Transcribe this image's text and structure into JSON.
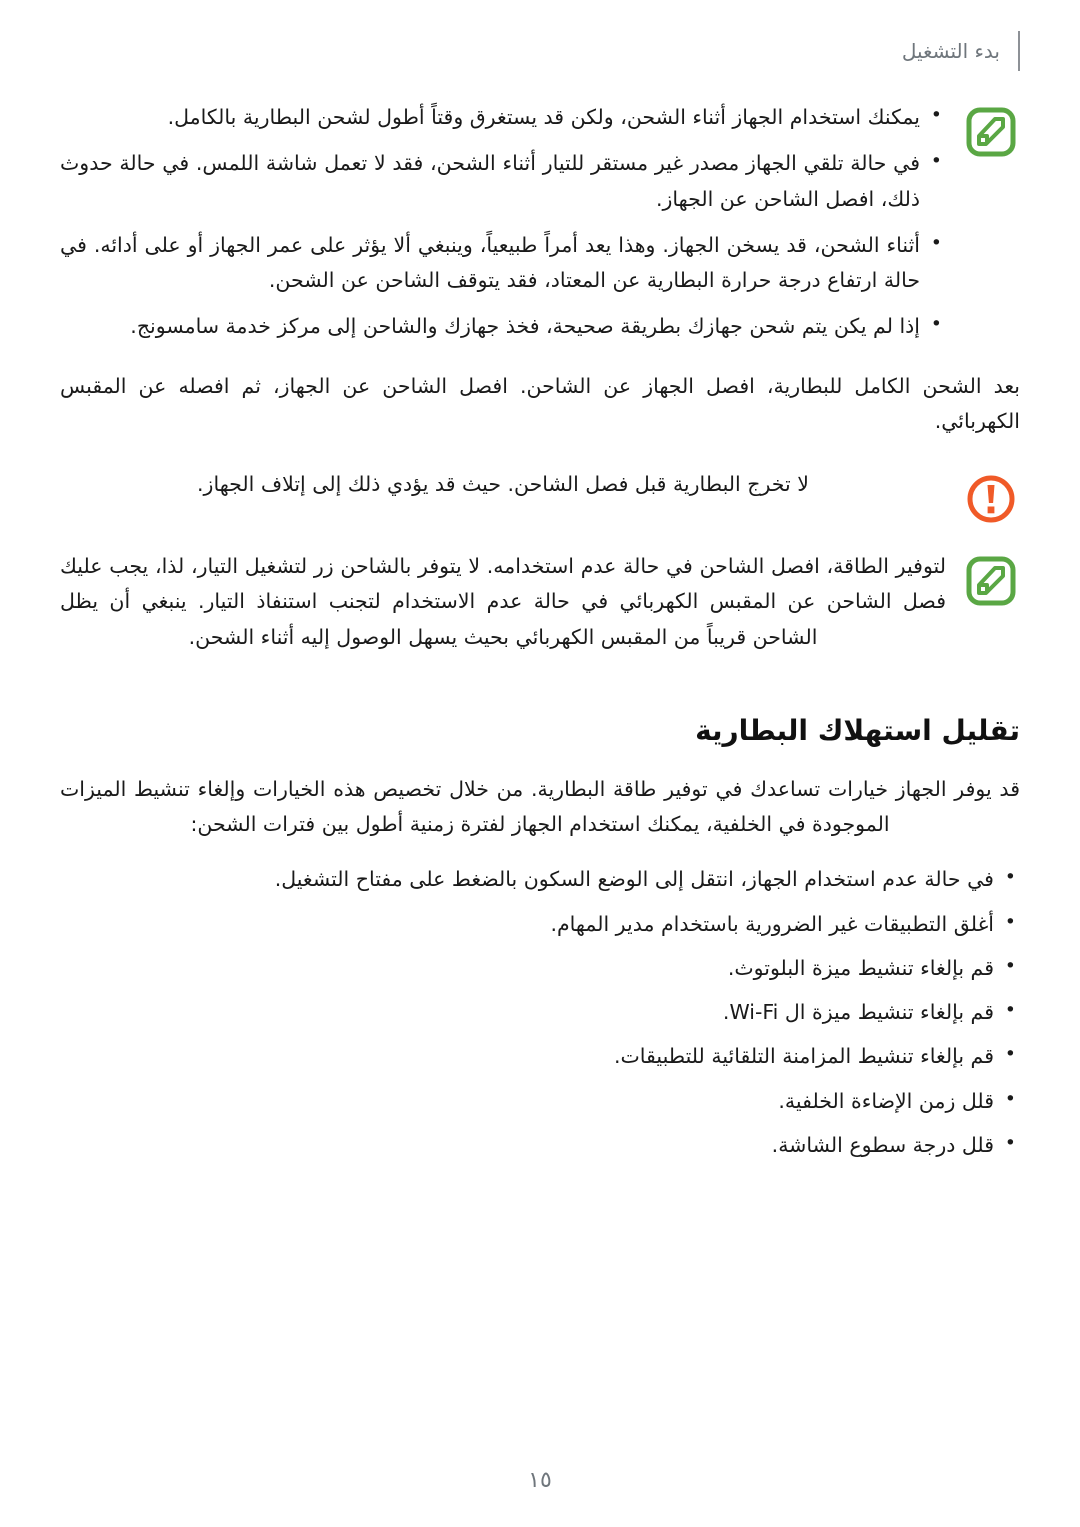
{
  "header": {
    "title": "بدء التشغيل",
    "rule_color": "#8d9196",
    "text_color": "#6f767c"
  },
  "colors": {
    "note_green": "#5aa744",
    "warning_orange": "#f05a28",
    "body_text": "#1a1a1a",
    "heading_text": "#111111",
    "page_background": "#ffffff"
  },
  "icons": {
    "note": "note-pencil-icon",
    "warning": "warning-exclamation-icon",
    "bullet": "bullet-dot"
  },
  "note_block_1": {
    "icon": "note-pencil-icon",
    "bullets": [
      "يمكنك استخدام الجهاز أثناء الشحن، ولكن قد يستغرق وقتاً أطول لشحن البطارية بالكامل.",
      "في حالة تلقي الجهاز مصدر غير مستقر للتيار أثناء الشحن، فقد لا تعمل شاشة اللمس. في حالة حدوث ذلك، افصل الشاحن عن الجهاز.",
      "أثناء الشحن، قد يسخن الجهاز. وهذا يعد أمراً طبيعياً، وينبغي ألا يؤثر على عمر الجهاز أو على أدائه. في حالة ارتفاع درجة حرارة البطارية عن المعتاد، فقد يتوقف الشاحن عن الشحن.",
      "إذا لم يكن يتم شحن جهازك بطريقة صحيحة، فخذ جهازك والشاحن إلى مركز خدمة سامسونج."
    ]
  },
  "paragraph_after_notes": "بعد الشحن الكامل للبطارية، افصل الجهاز عن الشاحن. افصل الشاحن عن الجهاز، ثم افصله عن المقبس الكهربائي.",
  "warning_block": {
    "icon": "warning-exclamation-icon",
    "text": "لا تخرج البطارية قبل فصل الشاحن. حيث قد يؤدي ذلك إلى إتلاف الجهاز."
  },
  "note_block_2": {
    "icon": "note-pencil-icon",
    "text": "لتوفير الطاقة، افصل الشاحن في حالة عدم استخدامه. لا يتوفر بالشاحن زر لتشغيل التيار، لذا، يجب عليك فصل الشاحن عن المقبس الكهربائي في حالة عدم الاستخدام لتجنب استنفاذ التيار. ينبغي أن يظل الشاحن قريباً من المقبس الكهربائي بحيث يسهل الوصول إليه أثناء الشحن."
  },
  "section": {
    "heading": "تقليل استهلاك البطارية",
    "intro": "قد يوفر الجهاز خيارات تساعدك في توفير طاقة البطارية. من خلال تخصيص هذه الخيارات وإلغاء تنشيط الميزات الموجودة في الخلفية، يمكنك استخدام الجهاز لفترة زمنية أطول بين فترات الشحن:",
    "tips": [
      "في حالة عدم استخدام الجهاز، انتقل إلى الوضع السكون بالضغط على مفتاح التشغيل.",
      "أغلق التطبيقات غير الضرورية باستخدام مدير المهام.",
      "قم بإلغاء تنشيط ميزة البلوتوث.",
      "قم بإلغاء تنشيط ميزة ال Wi-Fi.",
      "قم بإلغاء تنشيط المزامنة التلقائية للتطبيقات.",
      "قلل زمن الإضاءة الخلفية.",
      "قلل درجة سطوع الشاشة."
    ]
  },
  "footer": {
    "page_number": "١٥"
  }
}
